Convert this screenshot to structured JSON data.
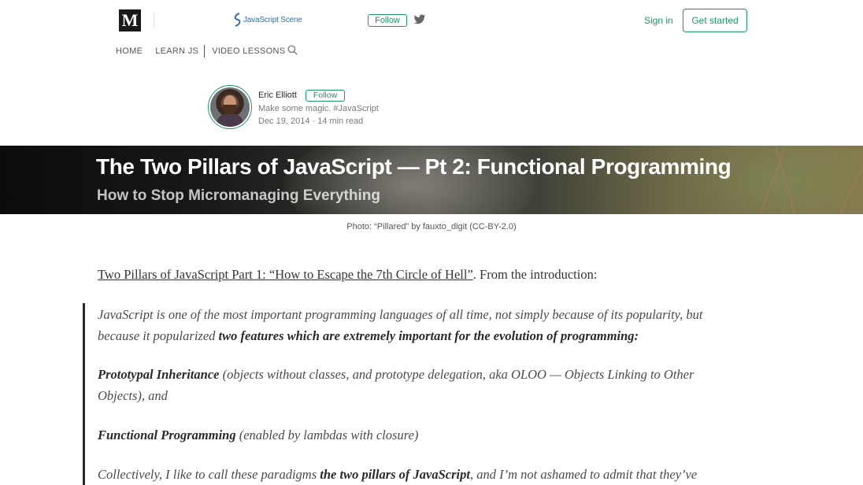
{
  "header": {
    "logo_letter": "M",
    "publication_name": "JavaScript Scene",
    "follow_label": "Follow",
    "signin_label": "Sign in",
    "get_started_label": "Get started",
    "accent_color": "#1c9963"
  },
  "nav": {
    "items": [
      {
        "label": "HOME"
      },
      {
        "label": "LEARN JS"
      },
      {
        "label": "VIDEO LESSONS"
      }
    ],
    "search_icon": "search-icon"
  },
  "author": {
    "name": "Eric Elliott",
    "follow_label": "Follow",
    "bio": "Make some magic. #JavaScript",
    "date": "Dec 19, 2014",
    "read_time": "14 min read"
  },
  "hero": {
    "title": "The Two Pillars of JavaScript — Pt 2: Functional Programming",
    "subtitle": "How to Stop Micromanaging Everything",
    "caption": "Photo: “Pillared” by fauxto_digit (CC-BY-2.0)"
  },
  "article": {
    "intro_link": "Two Pillars of JavaScript Part 1: “How to Escape the 7th Circle of Hell”",
    "intro_rest": ". From the introduction:",
    "quote": {
      "p1_line1": "JavaScript is one of the most important programming languages of all time, not simply because of its popularity, but",
      "p1_line2_plain": "because it popularized ",
      "p1_line2_bold": "two features which are extremely important for the evolution of programming:",
      "p2_bold": "Prototypal Inheritance",
      "p2_line1_rest": " (objects without classes, and prototype delegation, aka OLOO — Objects Linking to Other",
      "p2_line2": "Objects), and",
      "p3_bold": "Functional Programming",
      "p3_rest": " (enabled by lambdas with closure)",
      "p4_plain": "Collectively, I like to call these paradigms ",
      "p4_bold": "the two pillars of JavaScript",
      "p4_rest": ", and I’m not ashamed to admit that they’ve"
    }
  }
}
